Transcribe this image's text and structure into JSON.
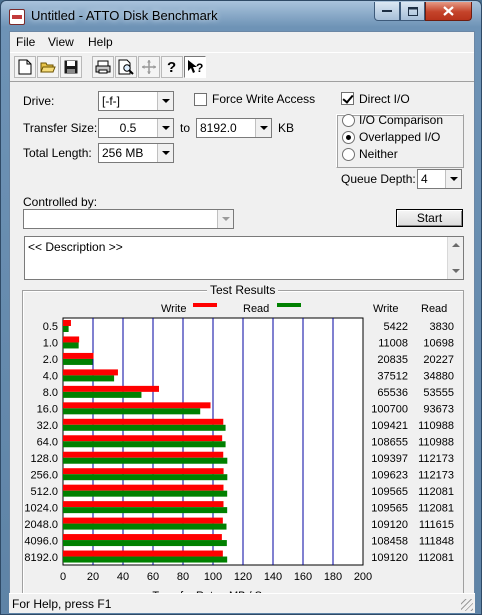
{
  "window": {
    "title": "Untitled - ATTO Disk Benchmark"
  },
  "menu": [
    "File",
    "View",
    "Help"
  ],
  "toolbar": {
    "buttons": [
      "new-document-icon",
      "open-folder-icon",
      "save-disk-icon",
      "print-icon",
      "print-preview-icon",
      "move-cross-icon",
      "help-question-icon",
      "context-help-icon"
    ]
  },
  "settings": {
    "drive_label": "Drive:",
    "drive_value": "[-f-]",
    "force_write_label": "Force Write Access",
    "force_write_checked": false,
    "direct_io_label": "Direct I/O",
    "direct_io_checked": true,
    "transfer_size_label": "Transfer Size:",
    "transfer_from": "0.5",
    "to_label": "to",
    "transfer_to": "8192.0",
    "kb_label": "KB",
    "total_length_label": "Total Length:",
    "total_length_value": "256 MB",
    "io_options": [
      "I/O Comparison",
      "Overlapped I/O",
      "Neither"
    ],
    "io_selected": "Overlapped I/O",
    "queue_depth_label": "Queue Depth:",
    "queue_depth_value": "4",
    "controlled_by_label": "Controlled by:",
    "controlled_by_value": "",
    "start_label": "Start",
    "description_text": "<< Description >>"
  },
  "results": {
    "title": "Test Results",
    "legend_write": "Write",
    "legend_read": "Read",
    "col_write": "Write",
    "col_read": "Read"
  },
  "colors": {
    "write": "#ff0000",
    "read": "#008000",
    "gridline": "#0000a0"
  },
  "chart_data": {
    "type": "bar",
    "orientation": "horizontal",
    "categories": [
      "0.5",
      "1.0",
      "2.0",
      "4.0",
      "8.0",
      "16.0",
      "32.0",
      "64.0",
      "128.0",
      "256.0",
      "512.0",
      "1024.0",
      "2048.0",
      "4096.0",
      "8192.0"
    ],
    "series": [
      {
        "name": "Write",
        "values": [
          5422,
          11008,
          20835,
          37512,
          65536,
          100700,
          109421,
          108655,
          109397,
          109623,
          109565,
          109565,
          109120,
          108458,
          109120
        ]
      },
      {
        "name": "Read",
        "values": [
          3830,
          10698,
          20227,
          34880,
          53555,
          93673,
          110988,
          110988,
          112173,
          112173,
          112081,
          112081,
          111615,
          111848,
          112081
        ]
      }
    ],
    "xlabel": "Transfer Rate - MB / Sec",
    "xticks": [
      "0",
      "20",
      "40",
      "60",
      "80",
      "100",
      "120",
      "140",
      "160",
      "180",
      "200"
    ],
    "xlim": [
      0,
      200
    ],
    "grid": true
  },
  "status_bar": {
    "text": "For Help, press F1"
  }
}
